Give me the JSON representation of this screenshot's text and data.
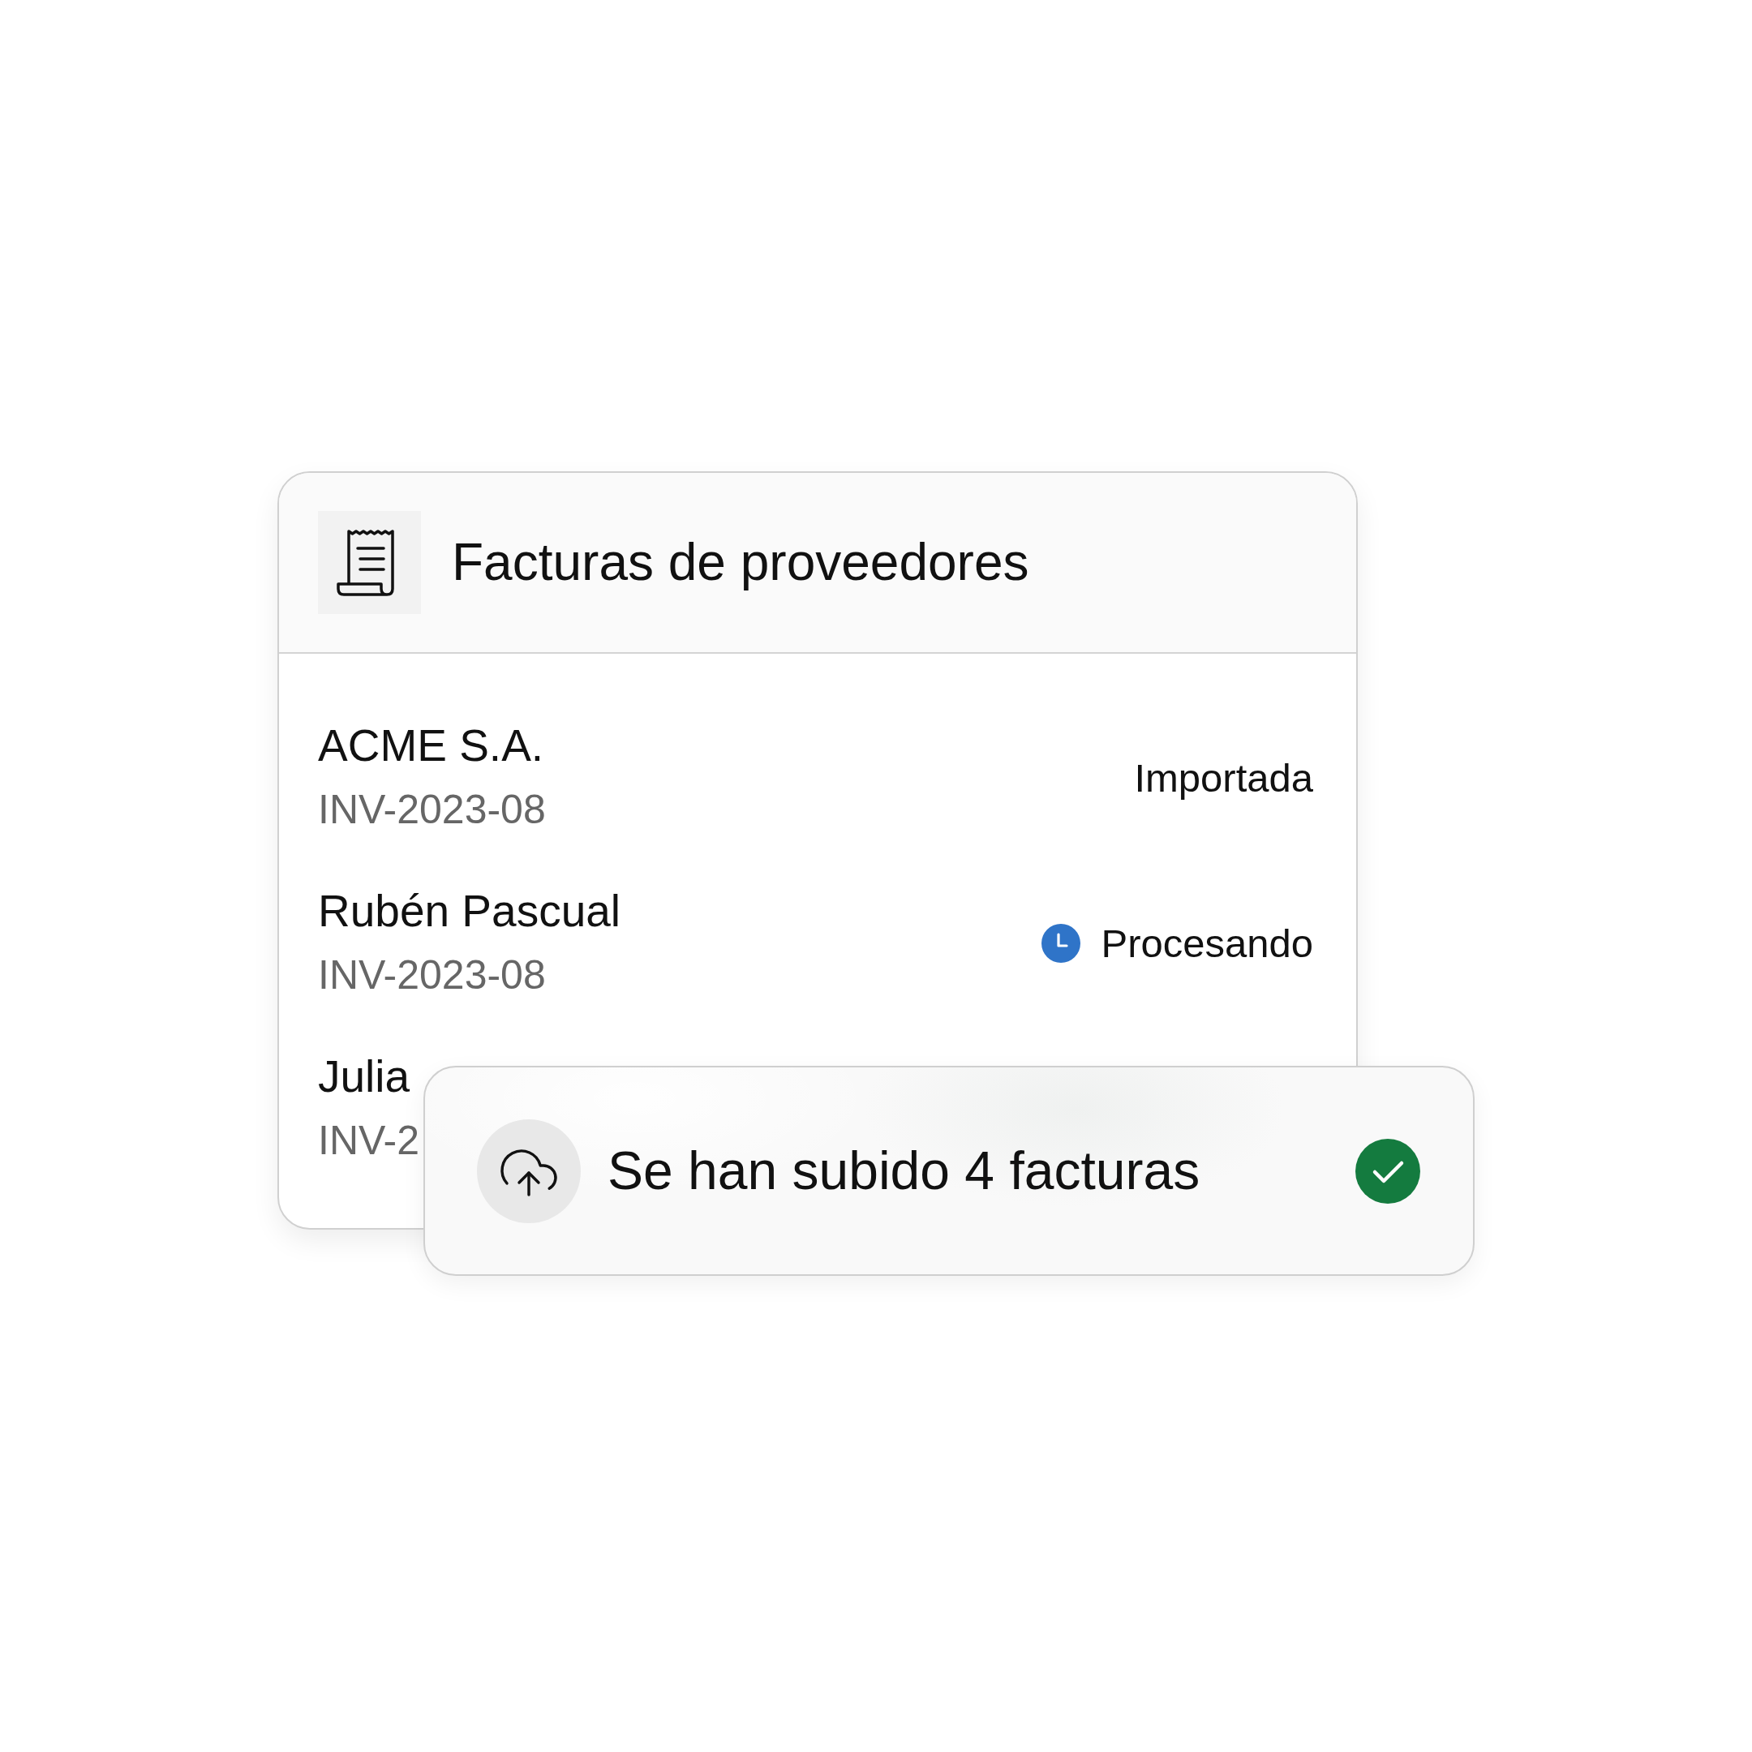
{
  "card": {
    "title": "Facturas de proveedores",
    "rows": [
      {
        "name": "ACME S.A.",
        "code": "INV-2023-08",
        "status": {
          "kind": "imported",
          "label": "Importada"
        }
      },
      {
        "name": "Rubén Pascual",
        "code": "INV-2023-08",
        "status": {
          "kind": "processing",
          "label": "Procesando"
        }
      },
      {
        "name": "Julia",
        "code": "INV-2"
      }
    ]
  },
  "toast": {
    "message": "Se han subido 4 facturas",
    "kind": "success"
  }
}
